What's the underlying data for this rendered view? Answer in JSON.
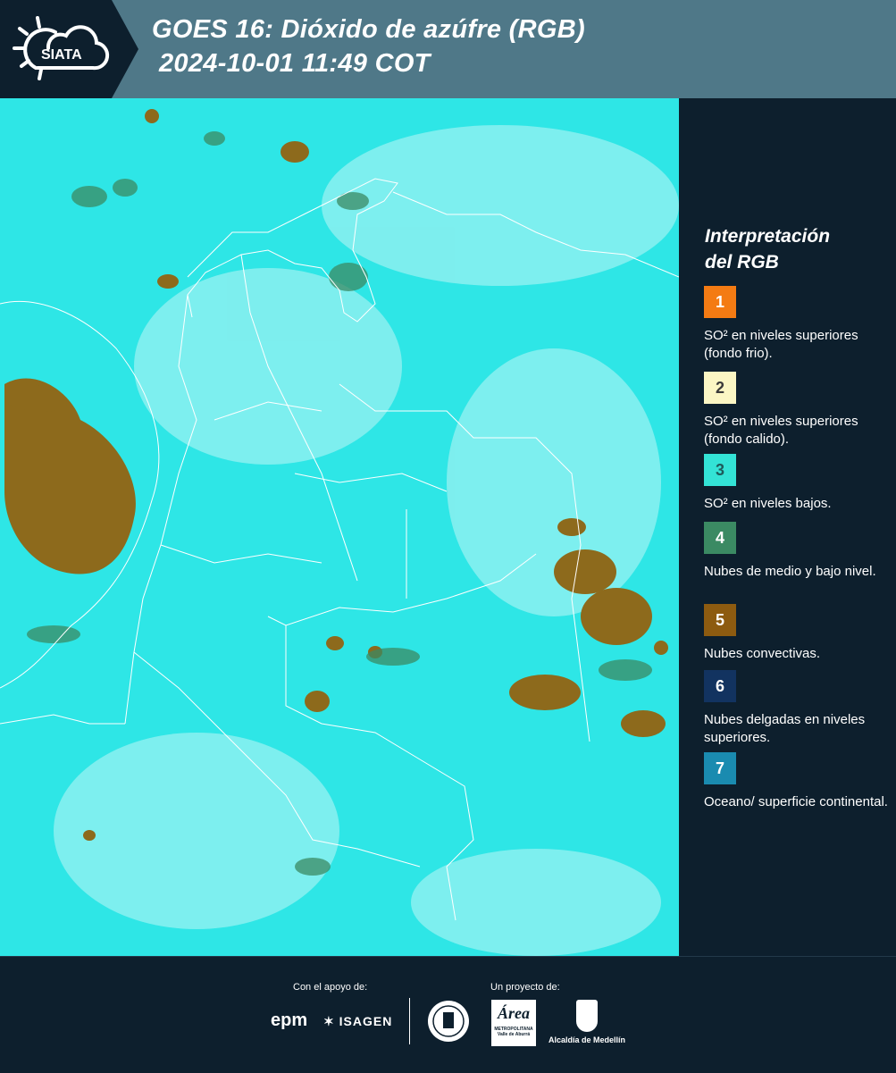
{
  "header": {
    "logo_text": "SIATA",
    "title_line1": "GOES 16: Dióxido de azúfre (RGB)",
    "title_line2": "2024-10-01 11:49 COT"
  },
  "legend": {
    "title_line1": "Interpretación",
    "title_line2": "del RGB",
    "items": [
      {
        "number": "1",
        "color": "#f47b13",
        "number_color": "#ffffff",
        "label": "SO² en niveles superiores (fondo frio)."
      },
      {
        "number": "2",
        "color": "#fbf6c4",
        "number_color": "#3a3a3a",
        "label": "SO² en niveles superiores (fondo calido)."
      },
      {
        "number": "3",
        "color": "#33e3d6",
        "number_color": "#1e5b5b",
        "label": "SO² en niveles bajos."
      },
      {
        "number": "4",
        "color": "#3b8a63",
        "number_color": "#ffffff",
        "label": "Nubes de medio y bajo nivel."
      },
      {
        "number": "5",
        "color": "#8d5b10",
        "number_color": "#ffffff",
        "label": "Nubes convectivas."
      },
      {
        "number": "6",
        "color": "#123360",
        "number_color": "#ffffff",
        "label": "Nubes delgadas en niveles superiores."
      },
      {
        "number": "7",
        "color": "#1a8bb0",
        "number_color": "#ffffff",
        "label": "Oceano/ superficie continental."
      }
    ]
  },
  "footer": {
    "support_label": "Con el apoyo de:",
    "project_label": "Un proyecto de:",
    "sponsor_1": "epm",
    "sponsor_2": "ISAGEN",
    "partner_1": "Área",
    "partner_1_sub": "METROPOLITANA Valle de Aburrá",
    "partner_2": "Alcaldía de Medellín"
  },
  "map": {
    "background_color": "#2ee6e6",
    "cloud_color": "#8d6a1c",
    "border_color": "#ffffff"
  }
}
